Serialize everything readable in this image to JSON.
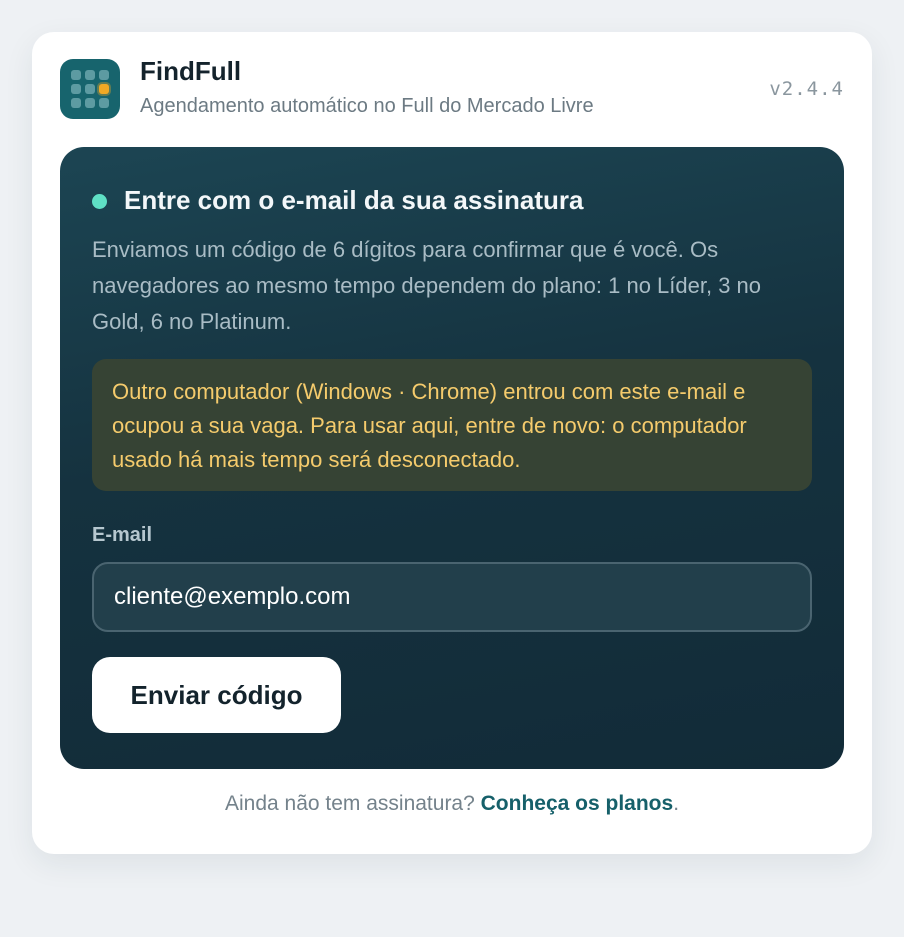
{
  "header": {
    "app_name": "FindFull",
    "tagline": "Agendamento automático no Full do Mercado Livre",
    "version": "v2.4.4",
    "logo_icon": "grid-calendar-icon",
    "brand_color": "#17646d",
    "highlight_color": "#f1a925"
  },
  "login": {
    "title": "Entre com o e-mail da sua assinatura",
    "description": "Enviamos um código de 6 dígitos para confirmar que é você. Os navegadores ao mesmo tempo dependem do plano: 1 no Líder, 3 no Gold, 6 no Platinum.",
    "warning": "Outro computador (Windows · Chrome) entrou com este e-mail e ocupou a sua vaga. Para usar aqui, entre de novo: o computador usado há mais tempo será desconectado.",
    "email_label": "E-mail",
    "email_value": "cliente@exemplo.com",
    "submit_label": "Enviar código",
    "status_color": "#5fe0c5",
    "warning_color": "#f5cb6c"
  },
  "footer": {
    "prompt": "Ainda não tem assinatura?",
    "link_label": "Conheça os planos",
    "suffix": "."
  }
}
